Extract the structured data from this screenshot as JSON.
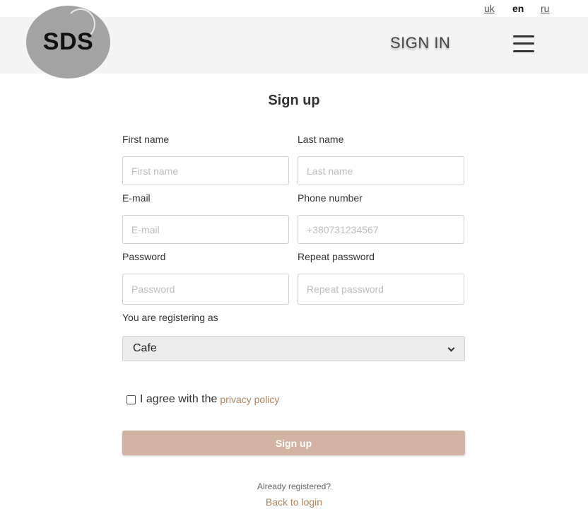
{
  "languages": {
    "uk": "uk",
    "en": "en",
    "ru": "ru",
    "active": "en"
  },
  "header": {
    "logo_text": "SDS",
    "signin_label": "SIGN IN"
  },
  "form": {
    "title": "Sign up",
    "first_name": {
      "label": "First name",
      "placeholder": "First name",
      "value": ""
    },
    "last_name": {
      "label": "Last name",
      "placeholder": "Last name",
      "value": ""
    },
    "email": {
      "label": "E-mail",
      "placeholder": "E-mail",
      "value": ""
    },
    "phone": {
      "label": "Phone number",
      "placeholder": "+380731234567",
      "value": ""
    },
    "password": {
      "label": "Password",
      "placeholder": "Password",
      "value": ""
    },
    "repeat_password": {
      "label": "Repeat password",
      "placeholder": "Repeat password",
      "value": ""
    },
    "role": {
      "label": "You are registering as",
      "selected": "Cafe"
    },
    "agree_text": "I agree with the",
    "privacy_link": "privacy policy",
    "submit_label": "Sign up",
    "already_registered": "Already registered?",
    "back_to_login": "Back to login"
  },
  "colors": {
    "accent": "#b0825c",
    "button": "#d2b3a2",
    "header_bg": "#f4f4f4"
  }
}
